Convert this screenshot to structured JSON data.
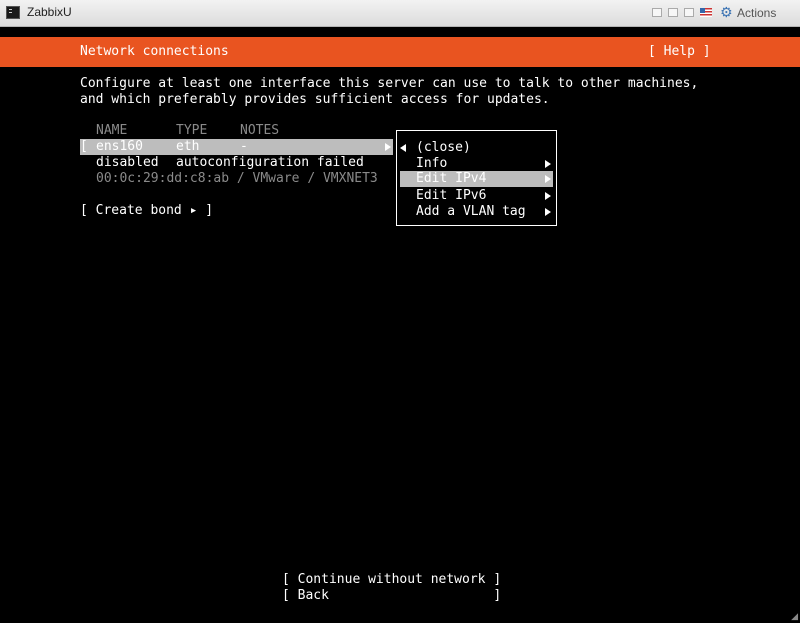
{
  "window": {
    "title": "ZabbixU",
    "actions_label": "Actions",
    "icons": [
      "terminal-icon",
      "window-button-icon",
      "window-button-icon",
      "window-button-icon",
      "us-flag-icon",
      "gear-icon"
    ]
  },
  "header": {
    "title": "Network connections",
    "help": "[ Help ]"
  },
  "intro": {
    "line1": "Configure at least one interface this server can use to talk to other machines,",
    "line2": "and which preferably provides sufficient access for updates."
  },
  "table": {
    "columns": {
      "name": "NAME",
      "type": "TYPE",
      "notes": "NOTES"
    },
    "interface": {
      "bracket": "[",
      "name": "ens160",
      "type": "eth",
      "notes": "-",
      "status": "disabled",
      "status_detail": "autoconfiguration failed",
      "hardware": "00:0c:29:dd:c8:ab / VMware / VMXNET3"
    }
  },
  "create_bond": "[ Create bond ▸ ]",
  "menu": {
    "items": [
      {
        "label": "(close)"
      },
      {
        "label": "Info"
      },
      {
        "label": "Edit IPv4"
      },
      {
        "label": "Edit IPv6"
      },
      {
        "label": "Add a VLAN tag"
      }
    ],
    "selected": "Edit IPv4"
  },
  "footer": {
    "continue": "[ Continue without network ]",
    "back": "[ Back                     ]"
  },
  "colors": {
    "accent": "#e95420",
    "highlight": "#bdbdbd",
    "background": "#000000",
    "text": "#ffffff",
    "dim_text": "#8a8a8a"
  }
}
